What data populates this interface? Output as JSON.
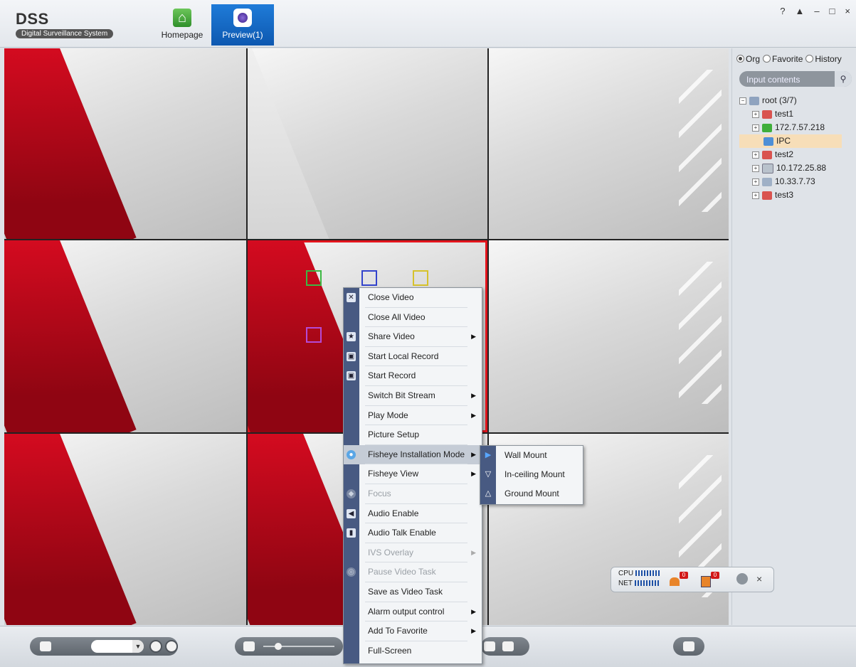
{
  "app": {
    "logo_title": "DSS",
    "logo_subtitle": "Digital Surveillance System"
  },
  "tabs": [
    {
      "label": "Homepage",
      "icon": "home-icon"
    },
    {
      "label": "Preview(1)",
      "icon": "camera-icon",
      "active": true
    }
  ],
  "window_controls": {
    "help": "?",
    "lock": "🔒",
    "minimize": "–",
    "maximize": "□",
    "close": "×"
  },
  "sidebar": {
    "radio_options": [
      {
        "label": "Org",
        "selected": true
      },
      {
        "label": "Favorite",
        "selected": false
      },
      {
        "label": "History",
        "selected": false
      }
    ],
    "search_placeholder": "Input contents",
    "tree": [
      {
        "label": "root (3/7)",
        "level": 0,
        "icon": "root-group-icon"
      },
      {
        "label": "test1",
        "level": 1,
        "icon": "camera-group-icon"
      },
      {
        "label": "172.7.57.218",
        "level": 1,
        "icon": "bus-device-icon"
      },
      {
        "label": "IPC",
        "level": 2,
        "icon": "ipc-camera-icon",
        "selected": true
      },
      {
        "label": "test2",
        "level": 1,
        "icon": "camera-group-icon"
      },
      {
        "label": "10.172.25.88",
        "level": 1,
        "icon": "nvr-device-icon"
      },
      {
        "label": "10.33.7.73",
        "level": 1,
        "icon": "dvr-device-icon"
      },
      {
        "label": "test3",
        "level": 1,
        "icon": "camera-group-icon"
      }
    ]
  },
  "context_menu": {
    "items": [
      {
        "label": "Close Video",
        "icon": "close-icon",
        "enabled": true,
        "submenu": false
      },
      {
        "label": "Close All Video",
        "icon": "",
        "enabled": true,
        "submenu": false
      },
      {
        "label": "Share Video",
        "icon": "star-icon",
        "enabled": true,
        "submenu": true
      },
      {
        "label": "Start Local Record",
        "icon": "local-record-icon",
        "enabled": true,
        "submenu": false
      },
      {
        "label": "Start Record",
        "icon": "record-icon",
        "enabled": true,
        "submenu": false
      },
      {
        "label": "Switch Bit Stream",
        "icon": "",
        "enabled": true,
        "submenu": true
      },
      {
        "label": "Play Mode",
        "icon": "",
        "enabled": true,
        "submenu": true
      },
      {
        "label": "Picture Setup",
        "icon": "",
        "enabled": true,
        "submenu": false
      },
      {
        "label": "Fisheye Installation Mode",
        "icon": "eye-icon",
        "enabled": true,
        "submenu": true,
        "highlighted": true
      },
      {
        "label": "Fisheye View",
        "icon": "",
        "enabled": true,
        "submenu": true
      },
      {
        "label": "Focus",
        "icon": "focus-icon",
        "enabled": false,
        "submenu": false
      },
      {
        "label": "Audio Enable",
        "icon": "speaker-icon",
        "enabled": true,
        "submenu": false
      },
      {
        "label": "Audio Talk Enable",
        "icon": "microphone-icon",
        "enabled": true,
        "submenu": false
      },
      {
        "label": "IVS Overlay",
        "icon": "",
        "enabled": false,
        "submenu": true
      },
      {
        "label": "Pause Video Task",
        "icon": "pause-icon",
        "enabled": false,
        "submenu": false
      },
      {
        "label": "Save as Video Task",
        "icon": "",
        "enabled": true,
        "submenu": false
      },
      {
        "label": "Alarm output control",
        "icon": "",
        "enabled": true,
        "submenu": true
      },
      {
        "label": "Add To Favorite",
        "icon": "",
        "enabled": true,
        "submenu": true
      },
      {
        "label": "Full-Screen",
        "icon": "",
        "enabled": true,
        "submenu": false
      }
    ],
    "fisheye_submenu": [
      {
        "label": "Wall Mount",
        "icon": "wall-mount-icon",
        "selected": true
      },
      {
        "label": "In-ceiling Mount",
        "icon": "ceiling-mount-icon",
        "selected": false
      },
      {
        "label": "Ground Mount",
        "icon": "ground-mount-icon",
        "selected": false
      }
    ]
  },
  "status_monitor": {
    "cpu_label": "CPU",
    "net_label": "NET",
    "alarm_count": "0",
    "event_count": "0"
  },
  "colors": {
    "accent_blue": "#1f7bd8",
    "selected_frame": "#e3141c",
    "menu_gutter": "#485a82"
  }
}
